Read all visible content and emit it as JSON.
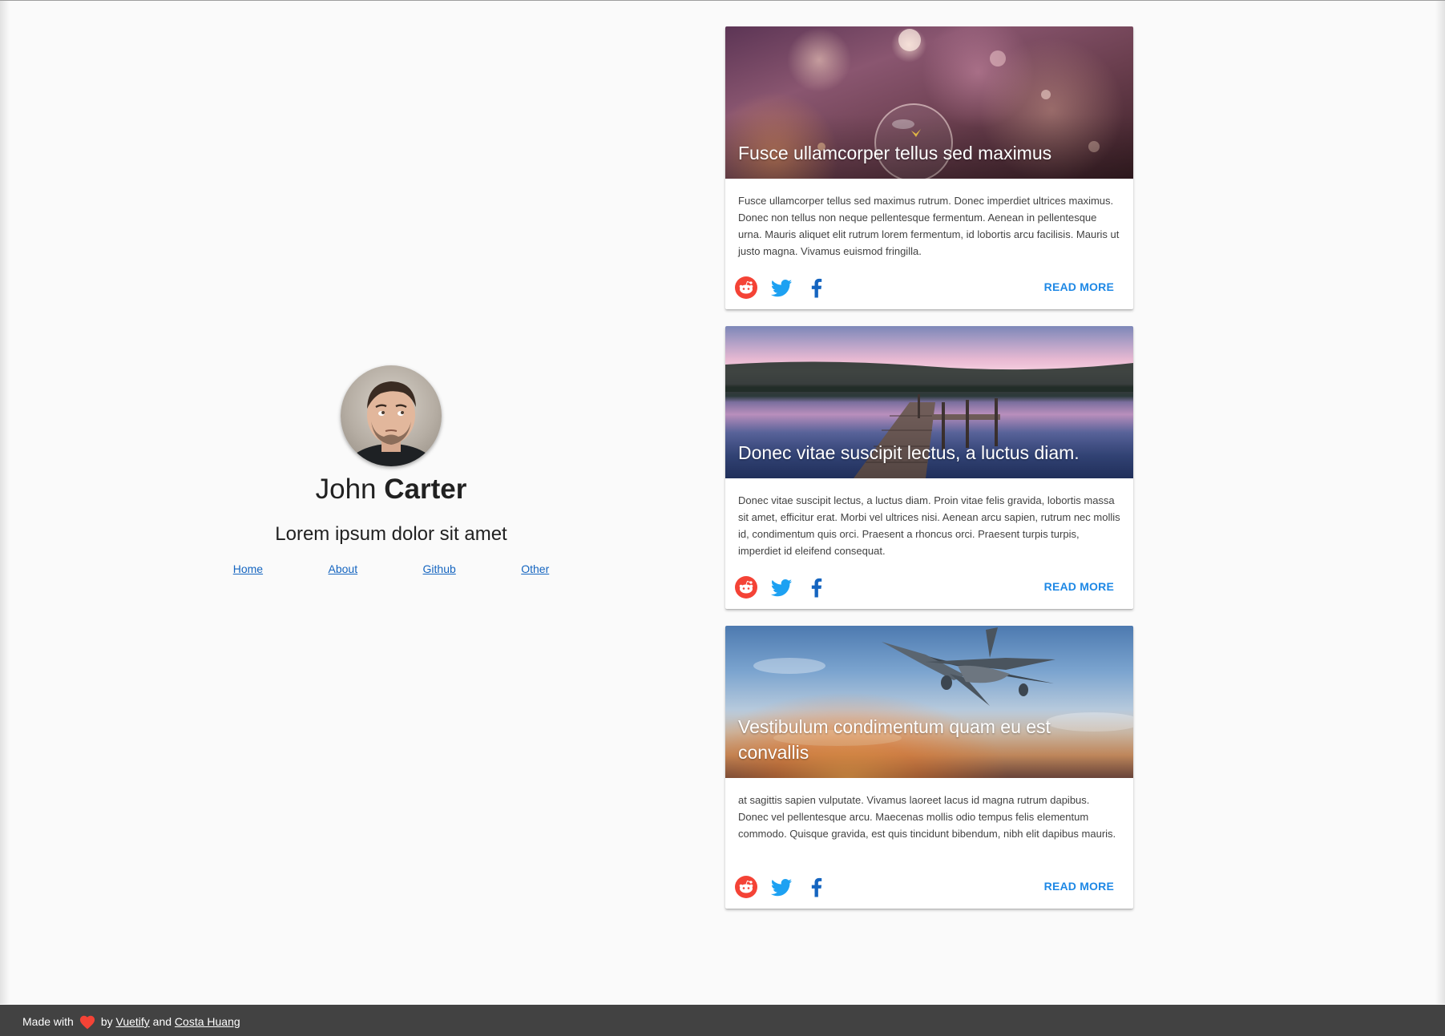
{
  "profile": {
    "first_name": "John",
    "last_name": "Carter",
    "tagline": "Lorem ipsum dolor sit amet",
    "links": [
      "Home",
      "About",
      "Github",
      "Other"
    ]
  },
  "cards": [
    {
      "title": "Fusce ullamcorper tellus sed maximus",
      "text": "Fusce ullamcorper tellus sed maximus rutrum. Donec imperdiet ultrices maximus. Donec non tellus non neque pellentesque fermentum. Aenean in pellentesque urna. Mauris aliquet elit rutrum lorem fermentum, id lobortis arcu facilisis. Mauris ut justo magna. Vivamus euismod fringilla.",
      "action": "READ MORE"
    },
    {
      "title": "Donec vitae suscipit lectus, a luctus diam.",
      "text": "Donec vitae suscipit lectus, a luctus diam. Proin vitae felis gravida, lobortis massa sit amet, efficitur erat. Morbi vel ultrices nisi. Aenean arcu sapien, rutrum nec mollis id, condimentum quis orci. Praesent a rhoncus orci. Praesent turpis turpis, imperdiet id eleifend consequat.",
      "action": "READ MORE"
    },
    {
      "title": "Vestibulum condimentum quam eu est convallis",
      "text": "at sagittis sapien vulputate. Vivamus laoreet lacus id magna rutrum dapibus. Donec vel pellentesque arcu. Maecenas mollis odio tempus felis elementum commodo. Quisque gravida, est quis tincidunt bibendum, nibh elit dapibus mauris.",
      "action": "READ MORE"
    }
  ],
  "social_icons": [
    "reddit-icon",
    "twitter-icon",
    "facebook-icon"
  ],
  "footer": {
    "made_with": "Made with",
    "by": "by",
    "link1": "Vuetify",
    "and": "and",
    "link2": "Costa Huang"
  },
  "colors": {
    "accent": "#1e88e5",
    "link": "#1565c0",
    "reddit": "#f44336",
    "twitter": "#1da1f2",
    "facebook": "#1565c0",
    "footer_bg": "#424242",
    "heart": "#f44336"
  }
}
